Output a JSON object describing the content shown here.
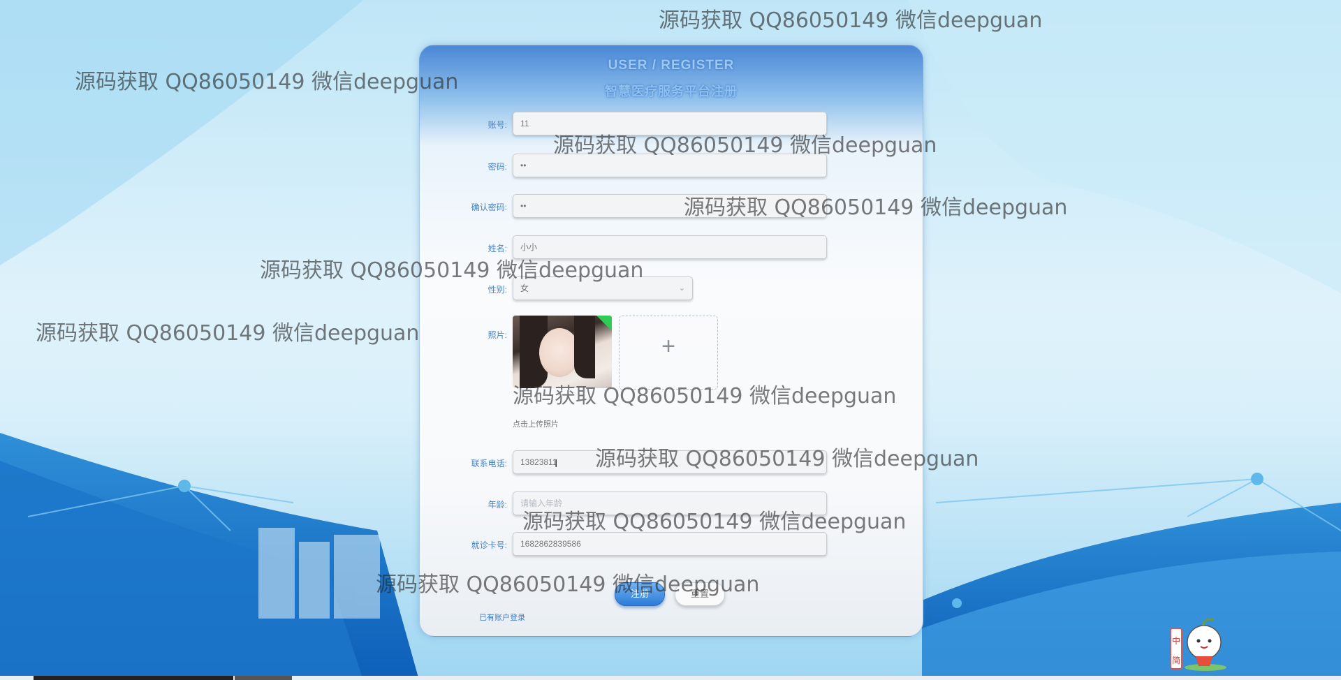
{
  "card": {
    "title_en": "USER / REGISTER",
    "title_zh": "智慧医疗服务平台注册"
  },
  "form": {
    "account": {
      "label": "账号:",
      "value": "11"
    },
    "password": {
      "label": "密码:",
      "value": "••"
    },
    "confirm_password": {
      "label": "确认密码:",
      "value": "••"
    },
    "name": {
      "label": "姓名:",
      "value": "小小"
    },
    "gender": {
      "label": "性别:",
      "value": "女"
    },
    "photo": {
      "label": "照片:",
      "hint": "点击上传照片"
    },
    "phone": {
      "label": "联系电话:",
      "value": "13823811"
    },
    "age": {
      "label": "年龄:",
      "placeholder": "请输入年龄"
    },
    "card_no": {
      "label": "就诊卡号:",
      "value": "1682862839586"
    }
  },
  "buttons": {
    "register": "注册",
    "reset": "重置"
  },
  "login_link": "已有账户登录",
  "watermark_text": "源码获取 QQ86050149 微信deepguan",
  "mascot_text": "中\n简"
}
